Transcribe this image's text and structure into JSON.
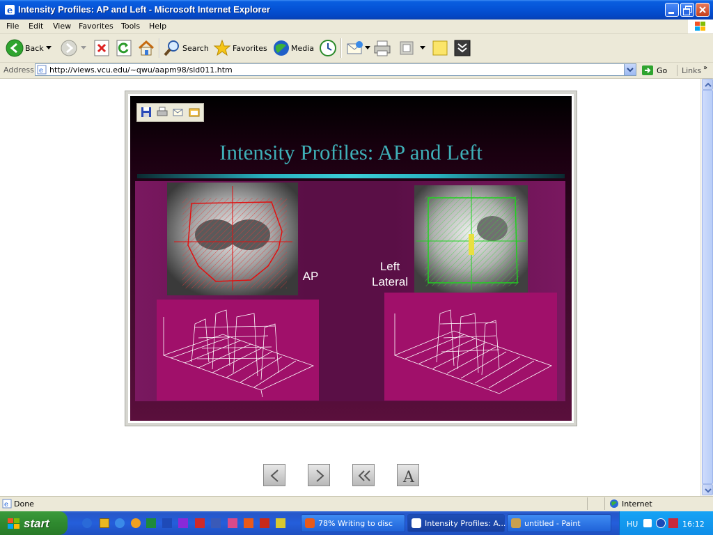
{
  "window": {
    "title": "Intensity Profiles: AP and Left - Microsoft Internet Explorer"
  },
  "menu": [
    "File",
    "Edit",
    "View",
    "Favorites",
    "Tools",
    "Help"
  ],
  "toolbar": {
    "back": "Back",
    "search": "Search",
    "favorites": "Favorites",
    "media": "Media"
  },
  "address": {
    "label": "Address",
    "url": "http://views.vcu.edu/~qwu/aapm98/sld011.htm",
    "go": "Go",
    "links": "Links"
  },
  "slide": {
    "title": "Intensity Profiles: AP and Left",
    "label_ap": "AP",
    "label_left_1": "Left",
    "label_left_2": "Lateral"
  },
  "status": {
    "text": "Done",
    "zone": "Internet"
  },
  "taskbar": {
    "start": "start",
    "tasks": [
      "78% Writing to disc",
      "Intensity Profiles: A...",
      "untitled - Paint"
    ],
    "language": "HU",
    "clock": "16:12"
  }
}
